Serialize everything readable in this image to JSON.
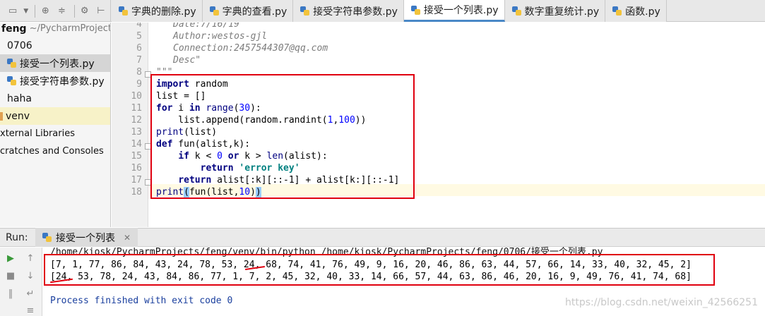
{
  "toolbar": {
    "icons": [
      "window-icon",
      "chevron-down-icon",
      "target-icon",
      "split-icon",
      "gear-icon",
      "collapse-icon"
    ]
  },
  "tabs": [
    {
      "label": "字典的删除.py",
      "active": false
    },
    {
      "label": "字典的查看.py",
      "active": false
    },
    {
      "label": "接受字符串参数.py",
      "active": false
    },
    {
      "label": "接受一个列表.py",
      "active": true
    },
    {
      "label": "数字重复统计.py",
      "active": false
    },
    {
      "label": "函数.py",
      "active": false
    }
  ],
  "project": {
    "root_name": "feng",
    "root_path": "~/PycharmProjects/",
    "folder_0706": "0706",
    "file_1": "接受一个列表.py",
    "file_2": "接受字符串参数.py",
    "folder_haha": "haha",
    "folder_venv": "venv",
    "external_libraries": "xternal Libraries",
    "scratches": "cratches and Consoles"
  },
  "editor": {
    "line_numbers": [
      "4",
      "5",
      "6",
      "7",
      "8",
      "9",
      "10",
      "11",
      "12",
      "13",
      "14",
      "15",
      "16",
      "17",
      "18"
    ],
    "doc": {
      "date": "Date:7/16/19",
      "author": "Author:westos-gjl",
      "connection": "Connection:2457544307@qq.com",
      "desc": "Desc\"",
      "close": "\"\"\""
    },
    "code": {
      "l9_kw": "import",
      "l9_rest": " random",
      "l10": "list = []",
      "l11_kw1": "for",
      "l11_a": " i ",
      "l11_kw2": "in",
      "l11_sp": " ",
      "l11_bi": "range",
      "l11_b": "(",
      "l11_num": "30",
      "l11_c": "):",
      "l12_a": "    list.append(random.randint(",
      "l12_n1": "1",
      "l12_comma": ",",
      "l12_n2": "100",
      "l12_b": "))",
      "l13_bi": "print",
      "l13_rest": "(list)",
      "l14_kw": "def",
      "l14_rest": " fun(alist,k):",
      "l15_ind": "    ",
      "l15_kw1": "if",
      "l15_a": " k < ",
      "l15_n": "0",
      "l15_sp": " ",
      "l15_kw2": "or",
      "l15_b": " k > ",
      "l15_bi": "len",
      "l15_c": "(alist):",
      "l16_ind": "        ",
      "l16_kw": "return",
      "l16_sp": " ",
      "l16_str": "'error key'",
      "l17_ind": "    ",
      "l17_kw": "return",
      "l17_rest": " alist[:k][::-1] + alist[k:][::-1]",
      "l18_bi": "print",
      "l18_p1": "(",
      "l18_a": "fun(list,",
      "l18_n": "10",
      "l18_b": ")",
      "l18_p2": ")"
    }
  },
  "run": {
    "label": "Run:",
    "tab_label": "接受一个列表",
    "command": "/home/kiosk/PycharmProjects/feng/venv/bin/python /home/kiosk/PycharmProjects/feng/0706/接受一个列表.py",
    "output_1": "[7, 1, 77, 86, 84, 43, 24, 78, 53, 24, 68, 74, 41, 76, 49, 9, 16, 20, 46, 86, 63, 44, 57, 66, 14, 33, 40, 32, 45, 2]",
    "output_2": "[24, 53, 78, 24, 43, 84, 86, 77, 1, 7, 2, 45, 32, 40, 33, 14, 66, 57, 44, 63, 86, 46, 20, 16, 9, 49, 76, 41, 74, 68]",
    "finished": "Process finished with exit code 0"
  },
  "watermark": "https://blog.csdn.net/weixin_42566251",
  "colors": {
    "highlight_box": "#e0000f",
    "active_tab_underline": "#4a88c7",
    "keyword": "#000080",
    "number": "#0000ff",
    "string": "#008080"
  }
}
